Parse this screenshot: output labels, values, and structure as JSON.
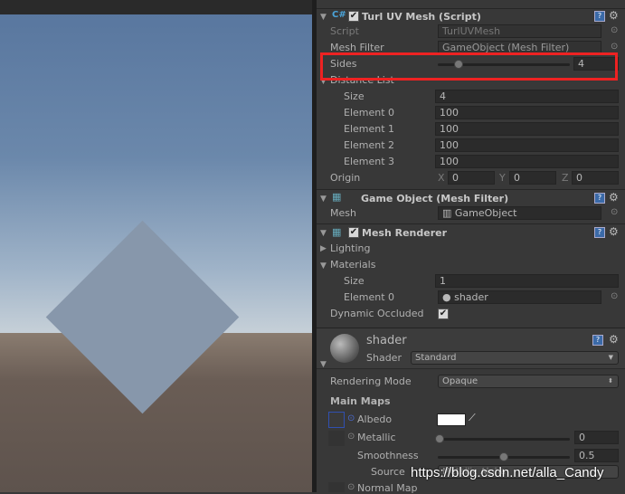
{
  "script_component": {
    "title": "Turl UV Mesh (Script)",
    "script_label": "Script",
    "script_value": "TurlUVMesh",
    "mesh_filter_label": "Mesh Filter",
    "mesh_filter_value": "GameObject (Mesh Filter)",
    "sides_label": "Sides",
    "sides_value": "4",
    "sides_fraction": 0.1,
    "distance_label": "Distance List",
    "size_label": "Size",
    "size_value": "4",
    "elements": [
      {
        "label": "Element 0",
        "value": "100"
      },
      {
        "label": "Element 1",
        "value": "100"
      },
      {
        "label": "Element 2",
        "value": "100"
      },
      {
        "label": "Element 3",
        "value": "100"
      }
    ],
    "origin_label": "Origin",
    "x_label": "X",
    "x": "0",
    "y_label": "Y",
    "y": "0",
    "z_label": "Z",
    "z": "0"
  },
  "mesh_filter": {
    "title": "Game Object (Mesh Filter)",
    "mesh_label": "Mesh",
    "mesh_value": "GameObject"
  },
  "mesh_renderer": {
    "title": "Mesh Renderer",
    "lighting": "Lighting",
    "materials": "Materials",
    "size_label": "Size",
    "size_value": "1",
    "element_label": "Element 0",
    "element_value": "shader",
    "dynamic_label": "Dynamic Occluded"
  },
  "material": {
    "name": "shader",
    "shader_label": "Shader",
    "shader_value": "Standard",
    "rendering_mode_label": "Rendering Mode",
    "rendering_mode_value": "Opaque",
    "main_maps": "Main Maps",
    "albedo": "Albedo",
    "albedo_color": "#ffffff",
    "metallic": "Metallic",
    "metallic_value": "0",
    "smoothness": "Smoothness",
    "smoothness_value": "0.5",
    "source": "Source",
    "source_value": "Metallic Alpha",
    "normal_map": "Normal Map"
  },
  "watermark": "https://blog.csdn.net/alla_Candy",
  "highlight_color": "#ee2222"
}
